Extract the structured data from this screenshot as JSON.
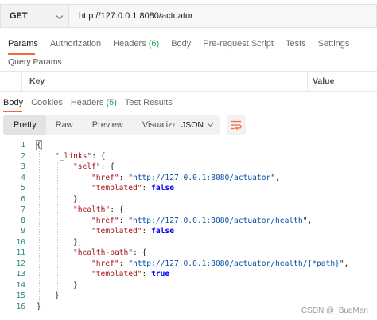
{
  "request": {
    "method": "GET",
    "url": "http://127.0.0.1:8080/actuator"
  },
  "request_tabs": [
    {
      "label": "Params",
      "count": ""
    },
    {
      "label": "Authorization",
      "count": ""
    },
    {
      "label": "Headers",
      "count": "(6)"
    },
    {
      "label": "Body",
      "count": ""
    },
    {
      "label": "Pre-request Script",
      "count": ""
    },
    {
      "label": "Tests",
      "count": ""
    },
    {
      "label": "Settings",
      "count": ""
    }
  ],
  "query_params": {
    "title": "Query Params",
    "key_header": "Key",
    "value_header": "Value"
  },
  "response_tabs": [
    {
      "label": "Body",
      "count": ""
    },
    {
      "label": "Cookies",
      "count": ""
    },
    {
      "label": "Headers",
      "count": "(5)"
    },
    {
      "label": "Test Results",
      "count": ""
    }
  ],
  "format_buttons": [
    "Pretty",
    "Raw",
    "Preview",
    "Visualize"
  ],
  "language": "JSON",
  "code_lines": [
    {
      "n": "1",
      "indent": 0,
      "parts": [
        [
          "p",
          "{"
        ]
      ]
    },
    {
      "n": "2",
      "indent": 1,
      "parts": [
        [
          "k",
          "\"_links\""
        ],
        [
          "p",
          ": {"
        ]
      ]
    },
    {
      "n": "3",
      "indent": 2,
      "parts": [
        [
          "k",
          "\"self\""
        ],
        [
          "p",
          ": {"
        ]
      ]
    },
    {
      "n": "4",
      "indent": 3,
      "parts": [
        [
          "k",
          "\"href\""
        ],
        [
          "p",
          ": \""
        ],
        [
          "u",
          "http://127.0.0.1:8080/actuator"
        ],
        [
          "p",
          "\","
        ]
      ]
    },
    {
      "n": "5",
      "indent": 3,
      "parts": [
        [
          "k",
          "\"templated\""
        ],
        [
          "p",
          ": "
        ],
        [
          "b",
          "false"
        ]
      ]
    },
    {
      "n": "6",
      "indent": 2,
      "parts": [
        [
          "p",
          "},"
        ]
      ]
    },
    {
      "n": "7",
      "indent": 2,
      "parts": [
        [
          "k",
          "\"health\""
        ],
        [
          "p",
          ": {"
        ]
      ]
    },
    {
      "n": "8",
      "indent": 3,
      "parts": [
        [
          "k",
          "\"href\""
        ],
        [
          "p",
          ": \""
        ],
        [
          "u",
          "http://127.0.0.1:8080/actuator/health"
        ],
        [
          "p",
          "\","
        ]
      ]
    },
    {
      "n": "9",
      "indent": 3,
      "parts": [
        [
          "k",
          "\"templated\""
        ],
        [
          "p",
          ": "
        ],
        [
          "b",
          "false"
        ]
      ]
    },
    {
      "n": "10",
      "indent": 2,
      "parts": [
        [
          "p",
          "},"
        ]
      ]
    },
    {
      "n": "11",
      "indent": 2,
      "parts": [
        [
          "k",
          "\"health-path\""
        ],
        [
          "p",
          ": {"
        ]
      ]
    },
    {
      "n": "12",
      "indent": 3,
      "parts": [
        [
          "k",
          "\"href\""
        ],
        [
          "p",
          ": \""
        ],
        [
          "u",
          "http://127.0.0.1:8080/actuator/health/{*path}"
        ],
        [
          "p",
          "\","
        ]
      ]
    },
    {
      "n": "13",
      "indent": 3,
      "parts": [
        [
          "k",
          "\"templated\""
        ],
        [
          "p",
          ": "
        ],
        [
          "b",
          "true"
        ]
      ]
    },
    {
      "n": "14",
      "indent": 2,
      "parts": [
        [
          "p",
          "}"
        ]
      ]
    },
    {
      "n": "15",
      "indent": 1,
      "parts": [
        [
          "p",
          "}"
        ]
      ]
    },
    {
      "n": "16",
      "indent": 0,
      "parts": [
        [
          "p",
          "}"
        ]
      ]
    }
  ],
  "watermark": "CSDN @_BugMan",
  "colors": {
    "accent": "#f26b3a",
    "count_green": "#26a15a",
    "json_key": "#a31515",
    "json_link": "#0451a5",
    "json_bool": "#0000ff",
    "line_number": "#2a8a80"
  }
}
